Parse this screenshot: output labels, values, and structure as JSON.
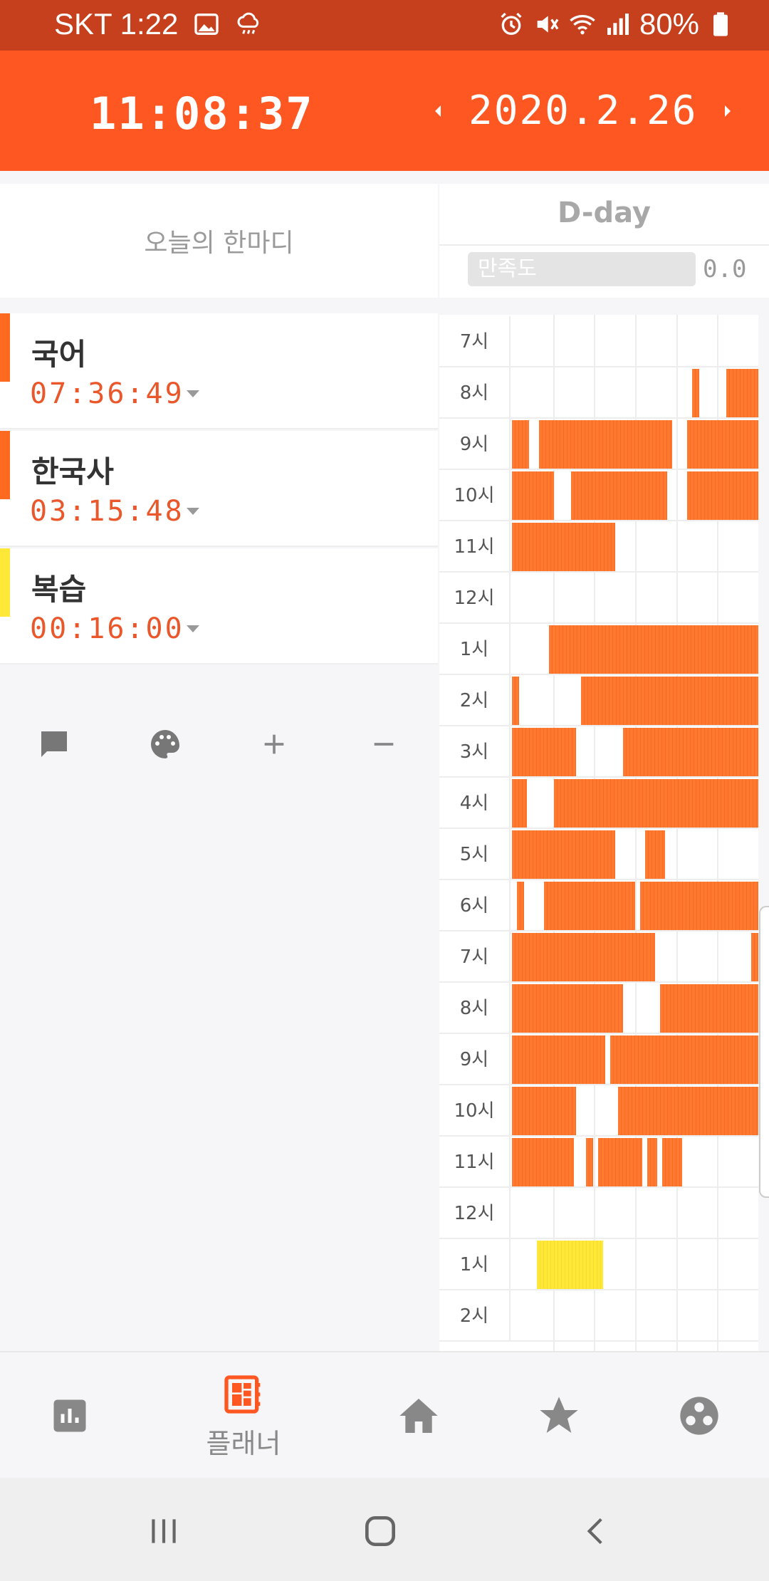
{
  "status_bar": {
    "carrier_time": "SKT 1:22",
    "battery": "80%",
    "icons": [
      "image-icon",
      "weather-rain-icon",
      "alarm-icon",
      "mute-icon",
      "wifi-icon",
      "signal-icon",
      "battery-icon"
    ]
  },
  "header": {
    "clock": "11:08:37",
    "date": "2020.2.26"
  },
  "motto": {
    "text": "오늘의 한마디"
  },
  "dday": {
    "title": "D-day",
    "satisfaction_label": "만족도",
    "satisfaction_value": "0.0"
  },
  "subjects": [
    {
      "name": "국어",
      "time": "07:36:49",
      "color": "#ff6a21"
    },
    {
      "name": "한국사",
      "time": "03:15:48",
      "color": "#ff6a21"
    },
    {
      "name": "복습",
      "time": "00:16:00",
      "color": "#ffe837"
    }
  ],
  "actions": [
    "comment-icon",
    "palette-icon",
    "plus-icon",
    "minus-icon"
  ],
  "timetable": {
    "hours": [
      "7시",
      "8시",
      "9시",
      "10시",
      "11시",
      "12시",
      "1시",
      "2시",
      "3시",
      "4시",
      "5시",
      "6시",
      "7시",
      "8시",
      "9시",
      "10시",
      "11시",
      "12시",
      "1시",
      "2시"
    ],
    "colors": {
      "study": "#ff7a30",
      "review": "#ffe837"
    }
  },
  "bottom_nav": {
    "items": [
      {
        "icon": "stats-icon",
        "label": ""
      },
      {
        "icon": "planner-icon",
        "label": "플래너"
      },
      {
        "icon": "home-icon",
        "label": ""
      },
      {
        "icon": "star-icon",
        "label": ""
      },
      {
        "icon": "group-icon",
        "label": ""
      }
    ],
    "active_color": "#ff5722",
    "inactive_color": "#888888"
  }
}
